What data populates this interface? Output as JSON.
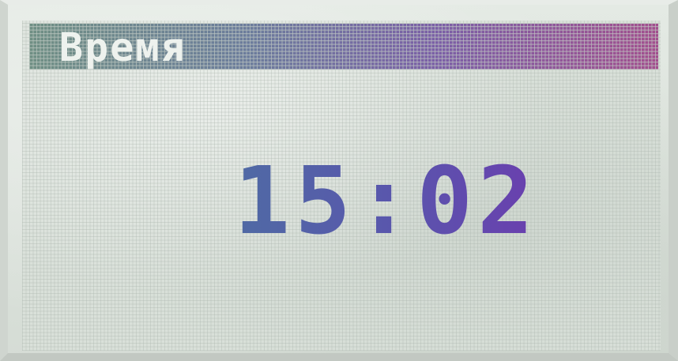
{
  "screen": {
    "title": "Время",
    "time": "15:02"
  },
  "colors": {
    "title_bar_start": "#6f8f84",
    "title_bar_end": "#a24f8e",
    "clock_start": "#4f6aa4",
    "clock_end": "#6a3fae",
    "lcd_background": "#d9e0d9"
  }
}
